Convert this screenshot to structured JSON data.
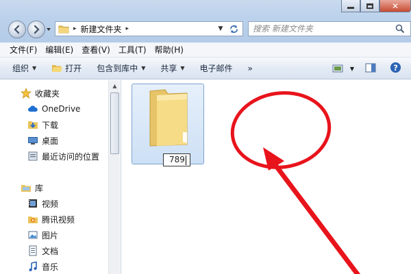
{
  "address": {
    "crumb_arrow": "▸",
    "current_folder": "新建文件夹",
    "trailing_arrow": "▸"
  },
  "search": {
    "placeholder": "搜索 新建文件夹"
  },
  "menu": {
    "items": [
      "文件(F)",
      "编辑(E)",
      "查看(V)",
      "工具(T)",
      "帮助(H)"
    ]
  },
  "toolbar": {
    "organize": "组织",
    "open": "打开",
    "include_in_library": "包含到库中",
    "share": "共享",
    "email": "电子邮件",
    "more": "»"
  },
  "nav": {
    "favorites_header": "收藏夹",
    "favorites": [
      "OneDrive",
      "下载",
      "桌面",
      "最近访问的位置"
    ],
    "libraries_header": "库",
    "libraries": [
      "视频",
      "腾讯视频",
      "图片",
      "文档",
      "音乐"
    ]
  },
  "content": {
    "folder_rename_value": "789"
  },
  "colors": {
    "annotation": "#e8141c",
    "selection_border": "#7da2ce",
    "folder_yellow": "#f3d57a"
  }
}
